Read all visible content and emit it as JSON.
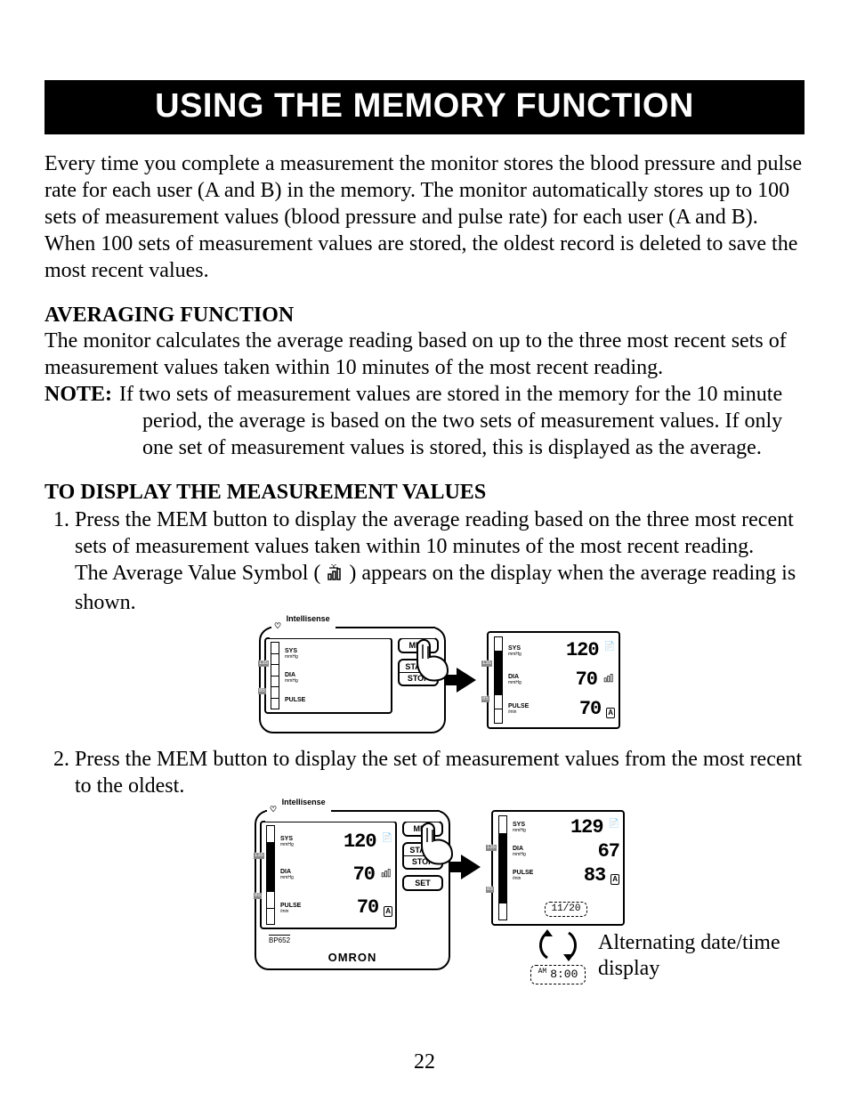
{
  "title": "USING THE MEMORY FUNCTION",
  "intro": "Every time you complete a measurement the monitor stores the blood pressure and pulse rate for each user (A and B) in the memory. The monitor automatically stores up to 100 sets of measurement values (blood pressure and pulse rate) for each user (A and B). When 100 sets of measurement values are stored, the oldest record is deleted to save the most recent values.",
  "section_avg": {
    "heading": "AVERAGING FUNCTION",
    "text": "The monitor calculates the average reading based on up to the three most recent sets of measurement values taken within 10 minutes of the most recent reading.",
    "note_label": "NOTE:",
    "note_text": "If two sets of measurement values are stored in the memory for the 10 minute period, the average is based on the two sets of measurement values. If only one set of measurement values is stored, this is displayed as the average."
  },
  "section_display": {
    "heading": "TO DISPLAY THE MEASUREMENT VALUES",
    "step1_a": "Press the MEM button to display the average reading based on the three most recent sets of measurement values taken within 10 minutes of the most recent reading.",
    "step1_b_pre": "The Average Value Symbol (",
    "step1_b_post": ") appears on the display when the average reading is shown.",
    "step2": "Press the MEM button to display the set of measurement values from the most recent to the oldest."
  },
  "device": {
    "brand": "Intellisense",
    "model": "BP652",
    "maker": "OMRON",
    "labels": {
      "sys": "SYS",
      "dia": "DIA",
      "pulse": "PULSE",
      "unit_bp": "mmHg",
      "unit_pulse": "/min"
    },
    "buttons": {
      "mem": "MEM",
      "start": "START",
      "stop": "STOP",
      "set": "SET"
    },
    "scale_ticks": {
      "hi": "135",
      "lo": "85"
    }
  },
  "readings": {
    "avg": {
      "sys": "120",
      "dia": "70",
      "pulse": "70",
      "user": "A"
    },
    "recent": {
      "sys": "120",
      "dia": "70",
      "pulse": "70",
      "user": "A"
    },
    "stored": {
      "sys": "129",
      "dia": "67",
      "pulse": "83",
      "user": "A",
      "date": "11/20",
      "time": "8:00",
      "ampm": "AM"
    }
  },
  "alt_caption": "Alternating date/time display",
  "page_number": "22"
}
